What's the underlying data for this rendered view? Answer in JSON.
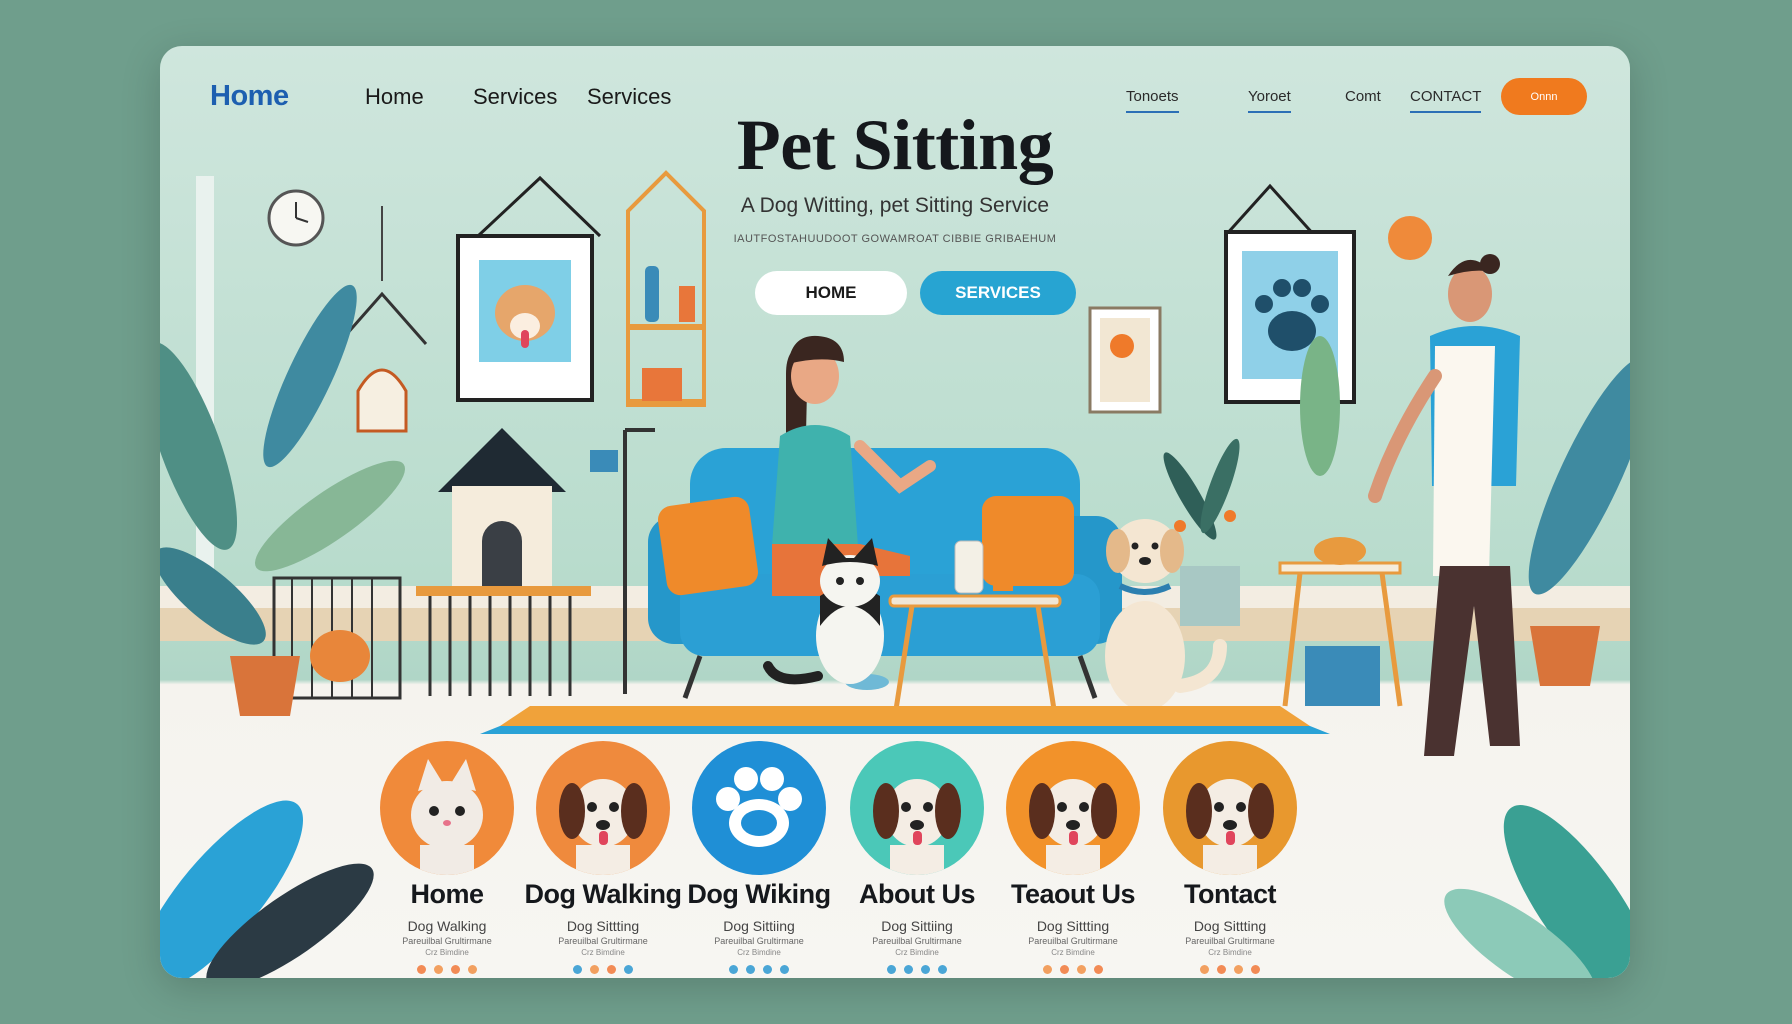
{
  "nav": {
    "logo": "Home",
    "links": [
      "Home",
      "Services",
      "Services"
    ],
    "right_links": [
      "Tonoets",
      "Yoroet",
      "Comt",
      "CONTACT"
    ],
    "cta": "Onnn"
  },
  "hero": {
    "title": "Pet Sitting",
    "subtitle": "A Dog Witting, pet Sitting Service",
    "small": "IAUTFOSTAHUUDOOT GOWAMROAT CIBBIE GRIBAEHUM",
    "buttons": {
      "home": "HOME",
      "services": "SERVICES"
    }
  },
  "services": [
    {
      "title": "Home",
      "line1": "Dog Walking",
      "line2": "Pareuilbal Grultirmane",
      "line3": "Crz Bimdine",
      "color": "#f08a3a",
      "icon": "cat-icon",
      "dots": [
        "#f28b55",
        "#f2a060",
        "#f28b55",
        "#f2a060"
      ]
    },
    {
      "title": "Dog Walking",
      "line1": "Dog Sittting",
      "line2": "Pareuilbal Grultirmane",
      "line3": "Crz Bimdine",
      "color": "#ef8a3d",
      "icon": "dog-icon",
      "dots": [
        "#4aa6d6",
        "#f2a060",
        "#f28b55",
        "#4aa6d6"
      ]
    },
    {
      "title": "Dog Wiking",
      "line1": "Dog Sittiing",
      "line2": "Pareuilbal Grultirmane",
      "line3": "Crz Bimdine",
      "color": "#1f8fd6",
      "icon": "paw-icon",
      "dots": [
        "#4aa6d6",
        "#4aa6d6",
        "#4aa6d6",
        "#4aa6d6"
      ]
    },
    {
      "title": "About Us",
      "line1": "Dog Sittiing",
      "line2": "Pareuilbal Grultirmane",
      "line3": "Crz Bimdine",
      "color": "#4bc8b8",
      "icon": "dog-icon",
      "dots": [
        "#4aa6d6",
        "#4aa6d6",
        "#4aa6d6",
        "#4aa6d6"
      ]
    },
    {
      "title": "Teaout Us",
      "line1": "Dog Sittting",
      "line2": "Pareuilbal Grultirmane",
      "line3": "Crz Bimdine",
      "color": "#f2922a",
      "icon": "dog-icon",
      "dots": [
        "#f2a060",
        "#f28b55",
        "#f2a060",
        "#f28b55"
      ]
    },
    {
      "title": "Tontact",
      "line1": "Dog Sittting",
      "line2": "Pareuilbal Grultirmane",
      "line3": "Crz Bimdine",
      "color": "#e8982e",
      "icon": "dog-icon",
      "dots": [
        "#f2a060",
        "#f28b55",
        "#f2a060",
        "#f28b55"
      ]
    }
  ]
}
